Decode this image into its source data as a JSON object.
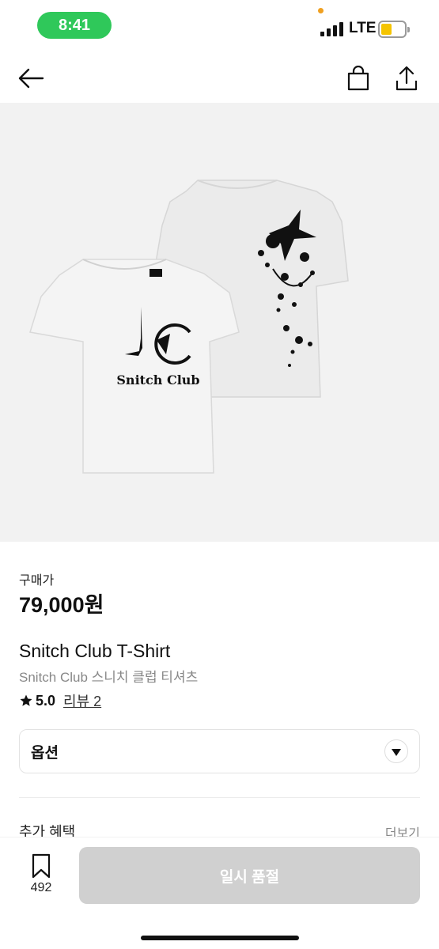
{
  "status_bar": {
    "time": "8:41",
    "network": "LTE"
  },
  "header": {
    "back_icon": "arrow-left-icon",
    "bag_icon": "shopping-bag-icon",
    "share_icon": "share-icon"
  },
  "product": {
    "image": {
      "front_logo": "Snitch Club",
      "front_tag": "S·C"
    },
    "price_label": "구매가",
    "price": "79,000원",
    "name_en": "Snitch Club T-Shirt",
    "name_ko": "Snitch Club 스니치 클럽 티셔츠",
    "rating": "5.0",
    "review_link": "리뷰 2"
  },
  "options": {
    "label": "옵션"
  },
  "benefits": {
    "title": "추가 혜택",
    "more": "더보기"
  },
  "bottom_bar": {
    "wish_count": "492",
    "soldout_label": "일시 품절"
  },
  "colors": {
    "status_green": "#2fc85a",
    "battery_yellow": "#f5c400",
    "disabled_button": "#d0d0d0"
  }
}
